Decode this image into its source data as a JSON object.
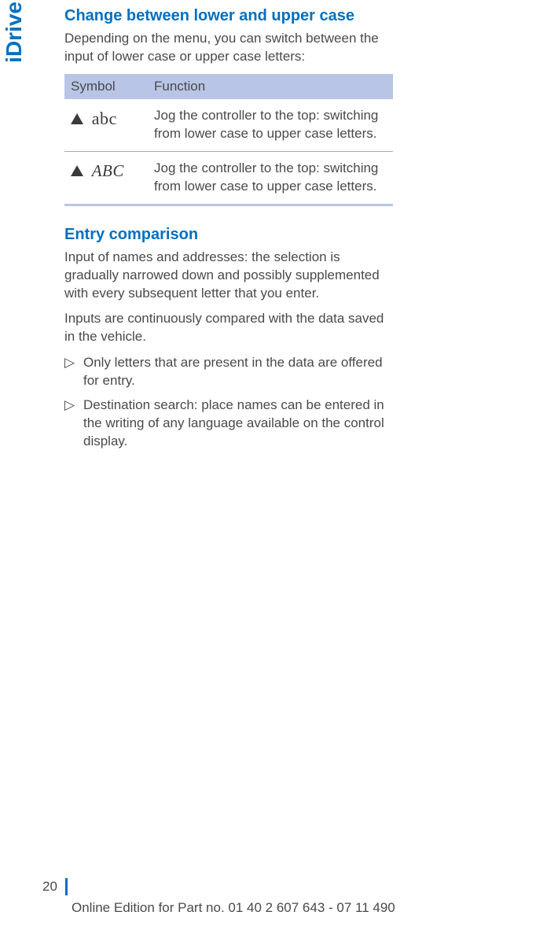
{
  "sideTab": "iDrive",
  "section1": {
    "heading": "Change between lower and upper case",
    "intro": "Depending on the menu, you can switch be­tween the input of lower case or upper case let­ters:",
    "table": {
      "head": {
        "col1": "Symbol",
        "col2": "Function"
      },
      "rows": [
        {
          "symbolLabel": "abc",
          "function": "Jog the controller to the top: switching from lower case to up­per case letters."
        },
        {
          "symbolLabel": "ABC",
          "function": "Jog the controller to the top: switching from lower case to up­per case letters."
        }
      ]
    }
  },
  "section2": {
    "heading": "Entry comparison",
    "para1": "Input of names and addresses: the selection is gradually narrowed down and possibly supple­mented with every subsequent letter that you enter.",
    "para2": "Inputs are continuously compared with the data saved in the vehicle.",
    "bullets": [
      "Only letters that are present in the data are offered for entry.",
      "Destination search: place names can be en­tered in the writing of any language available on the control display."
    ]
  },
  "footer": {
    "pageNumber": "20",
    "edition": "Online Edition for Part no. 01 40 2 607 643 - 07 11 490"
  },
  "bulletMarker": "▷"
}
